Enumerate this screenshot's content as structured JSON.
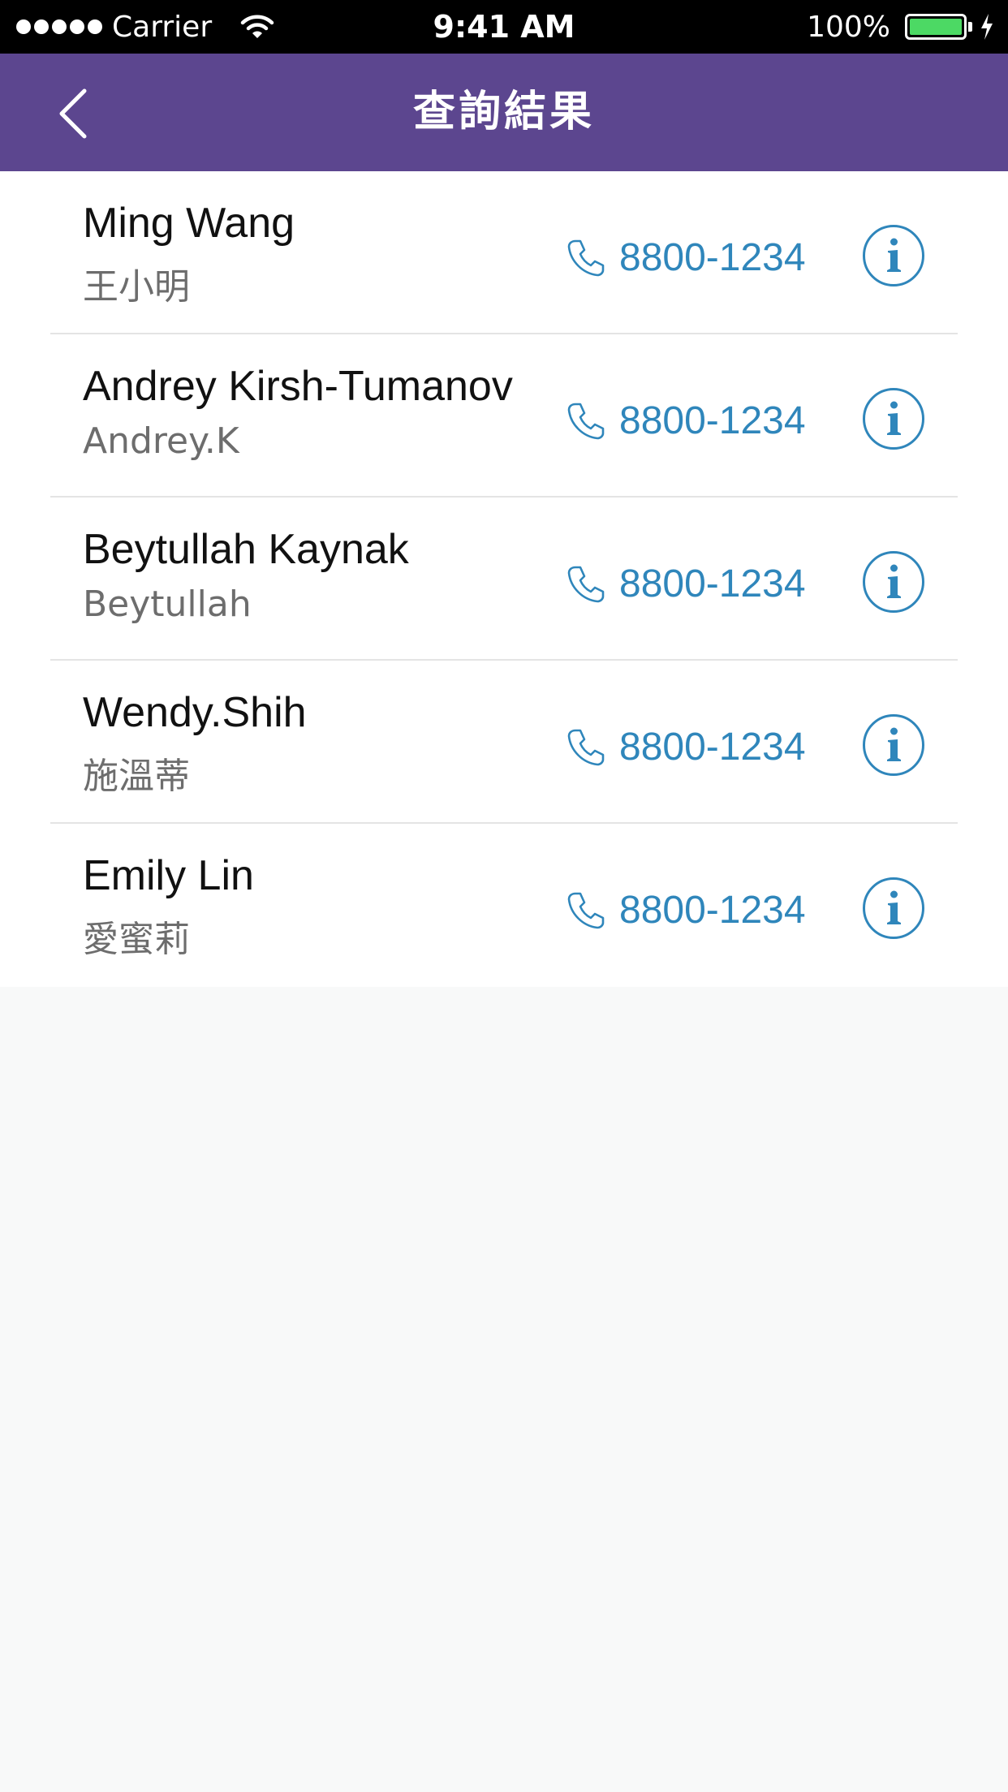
{
  "status_bar": {
    "carrier": "Carrier",
    "time": "9:41 AM",
    "battery_percent": "100%",
    "battery_level": 1.0,
    "battery_color": "#4cd964"
  },
  "nav": {
    "title": "查詢結果",
    "back_icon": "chevron-left-icon",
    "background": "#5c468f"
  },
  "accent_color": "#2f86bb",
  "contacts": [
    {
      "name": "Ming Wang",
      "alias": "王小明",
      "phone": "8800-1234"
    },
    {
      "name": "Andrey Kirsh-Tumanov",
      "alias": "Andrey.K",
      "phone": "8800-1234"
    },
    {
      "name": "Beytullah Kaynak",
      "alias": "Beytullah",
      "phone": "8800-1234"
    },
    {
      "name": "Wendy.Shih",
      "alias": "施溫蒂",
      "phone": "8800-1234"
    },
    {
      "name": "Emily Lin",
      "alias": "愛蜜莉",
      "phone": "8800-1234"
    }
  ]
}
